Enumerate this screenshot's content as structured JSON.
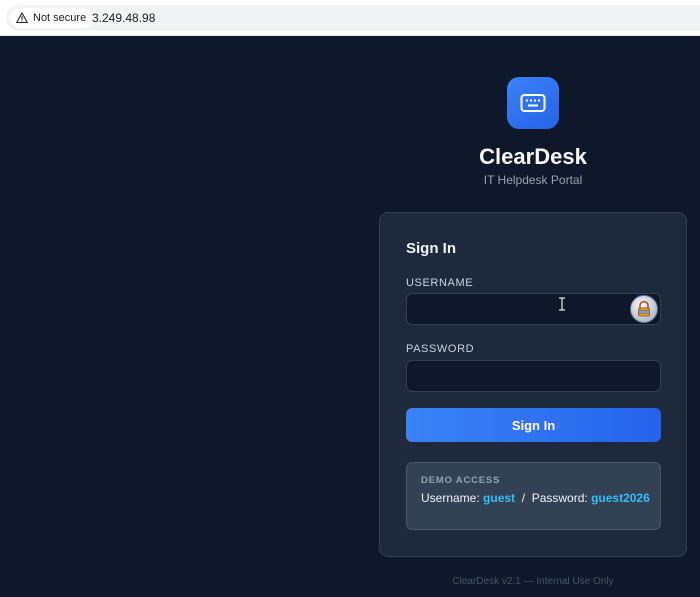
{
  "browser": {
    "security_label": "Not secure",
    "url": "3.249.48.98"
  },
  "brand": {
    "logo_icon": "keyboard-icon",
    "title": "ClearDesk",
    "subtitle": "IT Helpdesk Portal"
  },
  "login": {
    "heading": "Sign In",
    "username_label": "USERNAME",
    "username_value": "",
    "password_label": "PASSWORD",
    "password_value": "",
    "submit_label": "Sign In"
  },
  "demo": {
    "heading": "DEMO ACCESS",
    "username_prefix": "Username: ",
    "username": "guest",
    "separator": "  /  Password: ",
    "password": "guest2026"
  },
  "footer": "ClearDesk v2.1 — Internal Use Only",
  "colors": {
    "background": "#0f172a",
    "card": "#1e293b",
    "accent": "#3b82f6",
    "highlight": "#38bdf8"
  }
}
